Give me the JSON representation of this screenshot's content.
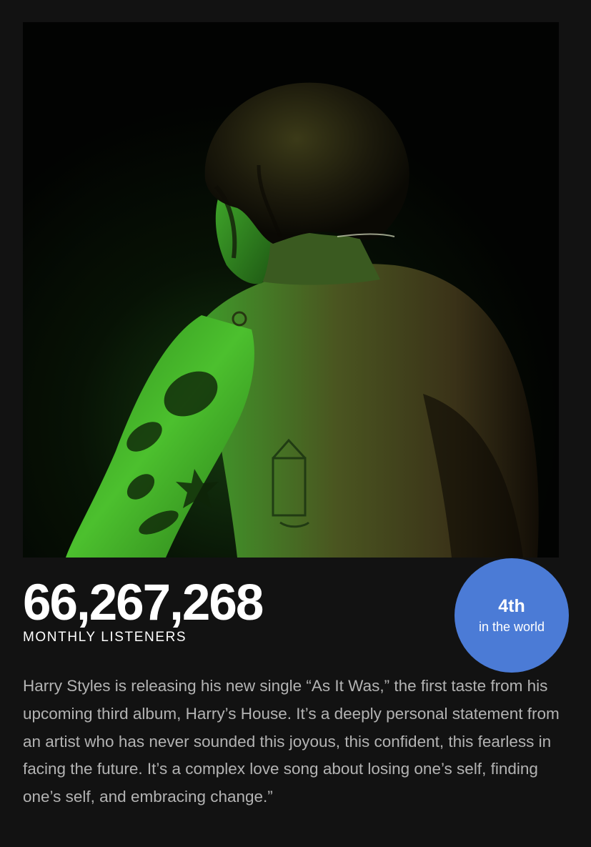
{
  "artist": {
    "image": "artist-photo-green-lit-shirtless-back-view"
  },
  "stats": {
    "monthly_listeners": "66,267,268",
    "monthly_listeners_label": "MONTHLY LISTENERS"
  },
  "rank": {
    "position": "4th",
    "scope": "in the world",
    "badge_color": "#4b7bd6"
  },
  "bio": {
    "text": "Harry Styles is releasing his new single “As It Was,” the first taste from his upcoming third album, Harry’s House. It’s a deeply personal statement from an artist who has never sounded this joyous, this confident, this fearless in facing the future. It’s a complex love song about losing one’s self, finding one’s self, and embracing change.”"
  },
  "theme": {
    "background": "#121212",
    "text_primary": "#ffffff",
    "text_secondary": "#b3b3b3"
  }
}
